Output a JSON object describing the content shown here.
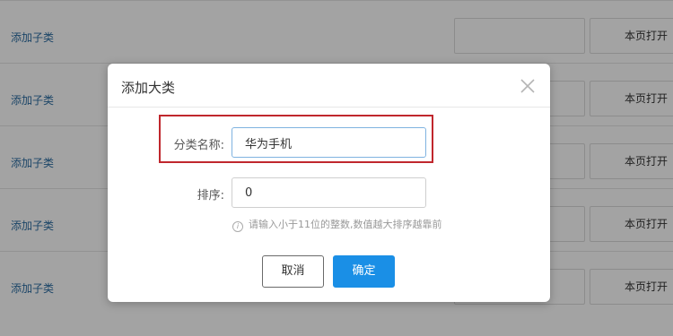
{
  "background": {
    "rows": [
      {
        "link": "添加子类",
        "select": "本页打开"
      },
      {
        "link": "添加子类",
        "select": "本页打开"
      },
      {
        "link": "添加子类",
        "select": "本页打开"
      },
      {
        "link": "添加子类",
        "select": "本页打开"
      },
      {
        "link": "添加子类",
        "select": "本页打开"
      }
    ]
  },
  "dialog": {
    "title": "添加大类",
    "name_label": "分类名称:",
    "name_value": "华为手机",
    "sort_label": "排序:",
    "sort_value": "0",
    "hint_icon": "i",
    "hint": "请输入小于11位的整数,数值越大排序越靠前",
    "cancel_label": "取消",
    "ok_label": "确定"
  },
  "colors": {
    "accent": "#1a8fe6",
    "highlight": "#c0272d",
    "link": "#2d6ea3"
  }
}
